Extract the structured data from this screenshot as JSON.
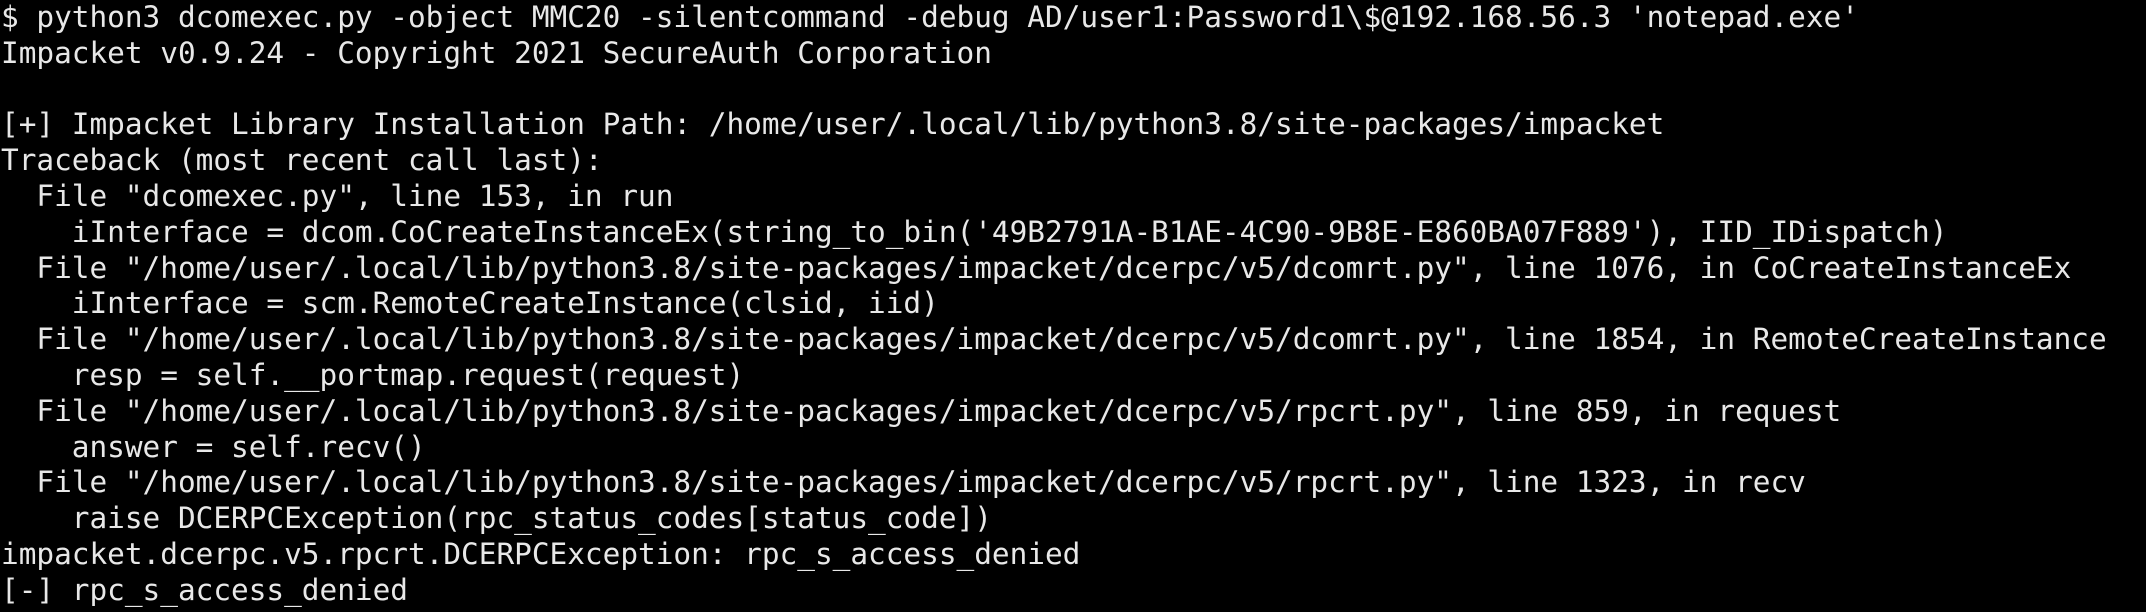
{
  "terminal": {
    "lines": [
      "$ python3 dcomexec.py -object MMC20 -silentcommand -debug AD/user1:Password1\\$@192.168.56.3 'notepad.exe'",
      "Impacket v0.9.24 - Copyright 2021 SecureAuth Corporation",
      "",
      "[+] Impacket Library Installation Path: /home/user/.local/lib/python3.8/site-packages/impacket",
      "Traceback (most recent call last):",
      "  File \"dcomexec.py\", line 153, in run",
      "    iInterface = dcom.CoCreateInstanceEx(string_to_bin('49B2791A-B1AE-4C90-9B8E-E860BA07F889'), IID_IDispatch)",
      "  File \"/home/user/.local/lib/python3.8/site-packages/impacket/dcerpc/v5/dcomrt.py\", line 1076, in CoCreateInstanceEx",
      "    iInterface = scm.RemoteCreateInstance(clsid, iid)",
      "  File \"/home/user/.local/lib/python3.8/site-packages/impacket/dcerpc/v5/dcomrt.py\", line 1854, in RemoteCreateInstance",
      "    resp = self.__portmap.request(request)",
      "  File \"/home/user/.local/lib/python3.8/site-packages/impacket/dcerpc/v5/rpcrt.py\", line 859, in request",
      "    answer = self.recv()",
      "  File \"/home/user/.local/lib/python3.8/site-packages/impacket/dcerpc/v5/rpcrt.py\", line 1323, in recv",
      "    raise DCERPCException(rpc_status_codes[status_code])",
      "impacket.dcerpc.v5.rpcrt.DCERPCException: rpc_s_access_denied",
      "[-] rpc_s_access_denied"
    ]
  },
  "colors": {
    "background": "#000000",
    "text": "#e8e8e8"
  }
}
